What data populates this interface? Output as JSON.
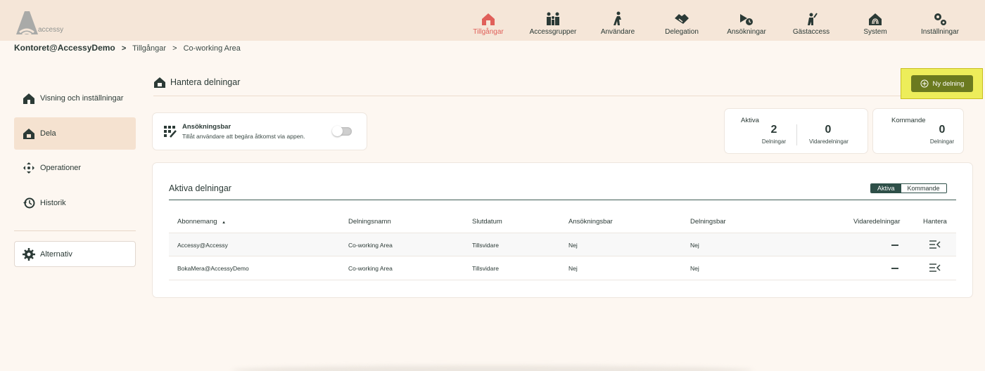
{
  "brand": {
    "name": "accessy"
  },
  "nav": [
    {
      "label": "Tillgångar",
      "icon": "house-icon",
      "active": true
    },
    {
      "label": "Accessgrupper",
      "icon": "family-icon",
      "active": false
    },
    {
      "label": "Användare",
      "icon": "walking-person-icon",
      "active": false
    },
    {
      "label": "Delegation",
      "icon": "handshake-icon",
      "active": false
    },
    {
      "label": "Ansökningar",
      "icon": "application-clock-icon",
      "active": false
    },
    {
      "label": "Gästaccess",
      "icon": "guest-person-icon",
      "active": false
    },
    {
      "label": "System",
      "icon": "fingerprint-house-icon",
      "active": false
    },
    {
      "label": "Inställningar",
      "icon": "gears-icon",
      "active": false
    }
  ],
  "breadcrumb": {
    "org": "Kontoret@AccessyDemo",
    "sep1": ">",
    "level1": "Tillgångar",
    "sep2": ">",
    "level2": "Co-working Area"
  },
  "sidebar": {
    "items": [
      {
        "label": "Visning och inställningar",
        "icon": "house-icon"
      },
      {
        "label": "Dela",
        "icon": "share-house-icon",
        "active": true
      },
      {
        "label": "Operationer",
        "icon": "move-arrows-icon"
      },
      {
        "label": "Historik",
        "icon": "history-icon"
      }
    ],
    "options_label": "Alternativ"
  },
  "header": {
    "title": "Hantera delningar",
    "new_button": "Ny delning"
  },
  "toggle_card": {
    "title": "Ansökningsbar",
    "description": "Tillåt användare att begära åtkomst via appen.",
    "enabled": false
  },
  "stats": {
    "aktiva": {
      "label": "Aktiva",
      "count1": "2",
      "sub1": "Delningar",
      "count2": "0",
      "sub2": "Vidaredelningar"
    },
    "kommande": {
      "label": "Kommande",
      "count": "0",
      "sub": "Delningar"
    }
  },
  "table": {
    "title": "Aktiva delningar",
    "segments": [
      "Aktiva",
      "Kommande"
    ],
    "columns": [
      "Abonnemang",
      "Delningsnamn",
      "Slutdatum",
      "Ansökningsbar",
      "Delningsbar",
      "Vidaredelningar",
      "Hantera"
    ],
    "sort_indicator": "▲",
    "rows": [
      [
        "Accessy@Accessy",
        "Co-working Area",
        "Tillsvidare",
        "Nej",
        "Nej"
      ],
      [
        "BokaMera@AccessyDemo",
        "Co-working Area",
        "Tillsvidare",
        "Nej",
        "Nej"
      ]
    ]
  },
  "colors": {
    "accent_active": "#e0605a",
    "brand_green": "#2e4f48",
    "new_button": "#6b7a1f",
    "highlight": "#eded5a"
  }
}
